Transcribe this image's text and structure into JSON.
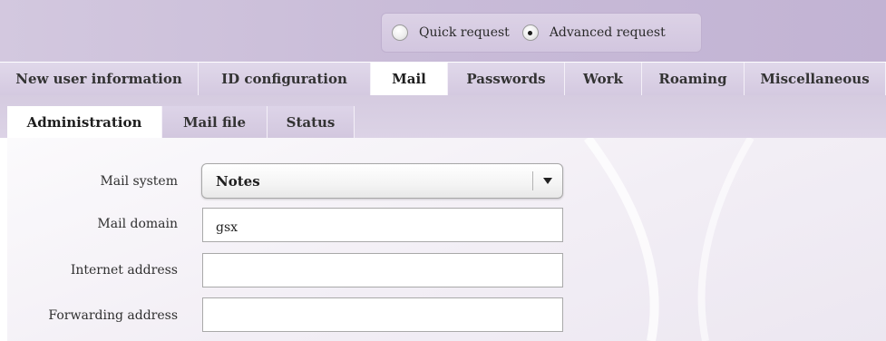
{
  "request_mode": {
    "options": [
      {
        "label": "Quick request",
        "selected": false
      },
      {
        "label": "Advanced request",
        "selected": true
      }
    ]
  },
  "main_tabs": [
    {
      "label": "New user information",
      "active": false
    },
    {
      "label": "ID configuration",
      "active": false
    },
    {
      "label": "Mail",
      "active": true
    },
    {
      "label": "Passwords",
      "active": false
    },
    {
      "label": "Work",
      "active": false
    },
    {
      "label": "Roaming",
      "active": false
    },
    {
      "label": "Miscellaneous",
      "active": false
    }
  ],
  "sub_tabs": [
    {
      "label": "Administration",
      "active": true
    },
    {
      "label": "Mail file",
      "active": false
    },
    {
      "label": "Status",
      "active": false
    }
  ],
  "form": {
    "mail_system": {
      "label": "Mail system",
      "value": "Notes"
    },
    "mail_domain": {
      "label": "Mail domain",
      "value": "gsx"
    },
    "internet_address": {
      "label": "Internet address",
      "value": ""
    },
    "forwarding_address": {
      "label": "Forwarding address",
      "value": ""
    }
  },
  "colors": {
    "band": "#c9bcd8",
    "tab_bg": "#d7cde2",
    "tab_active_bg": "#ffffff",
    "text": "#333333"
  }
}
